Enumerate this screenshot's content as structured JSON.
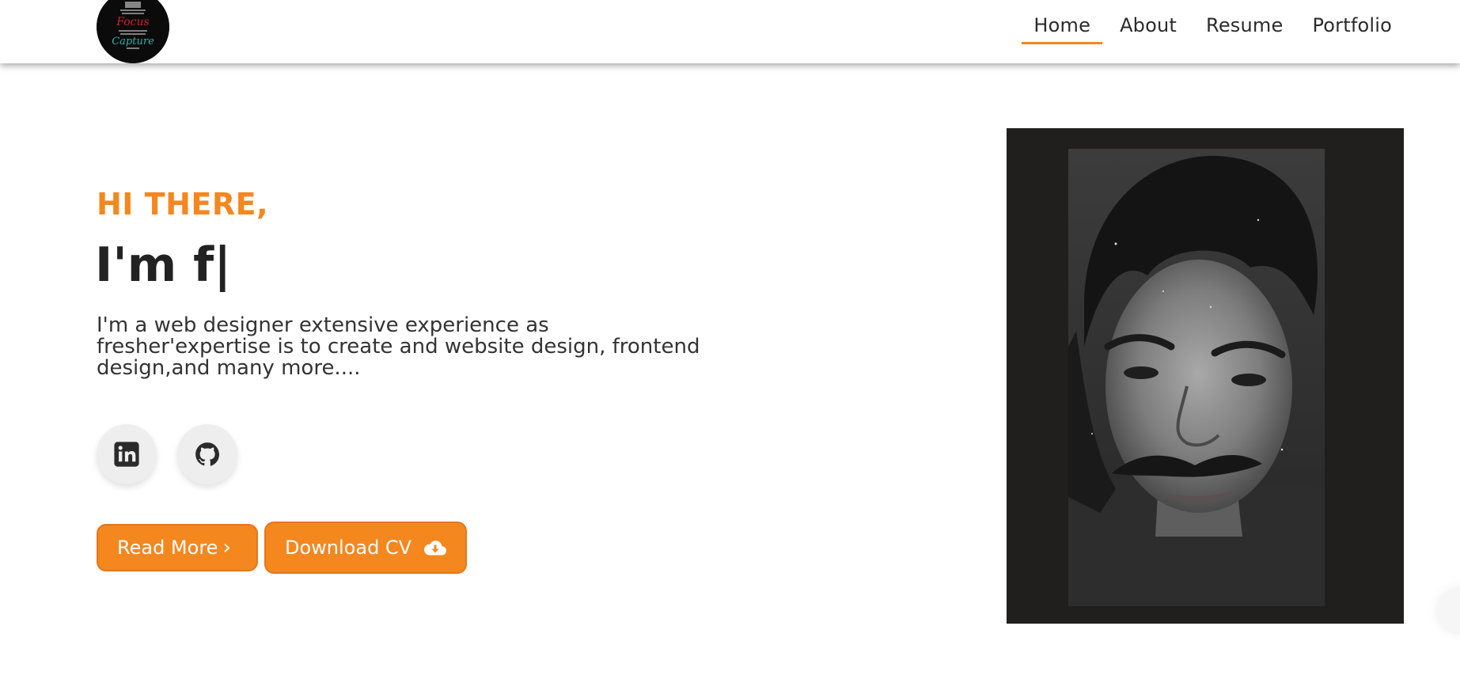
{
  "header": {
    "logo": {
      "alt_text_top": "Focus",
      "alt_text_bottom": "Capture"
    },
    "nav": [
      {
        "label": "Home",
        "active": true
      },
      {
        "label": "About",
        "active": false
      },
      {
        "label": "Resume",
        "active": false
      },
      {
        "label": "Portfolio",
        "active": false
      }
    ]
  },
  "hero": {
    "greeting": "HI THERE,",
    "headline_prefix": "I'm f",
    "cursor": "|",
    "bio": "I'm a web designer extensive experience as fresher'expertise is to create and website design, frontend design,and many more....",
    "social": [
      {
        "icon": "linkedin-icon"
      },
      {
        "icon": "github-icon"
      }
    ],
    "buttons": {
      "read_more": "Read More",
      "download_cv": "Download CV"
    }
  },
  "colors": {
    "accent": "#f5871f",
    "text": "#222222",
    "frame": "#201f1e"
  }
}
